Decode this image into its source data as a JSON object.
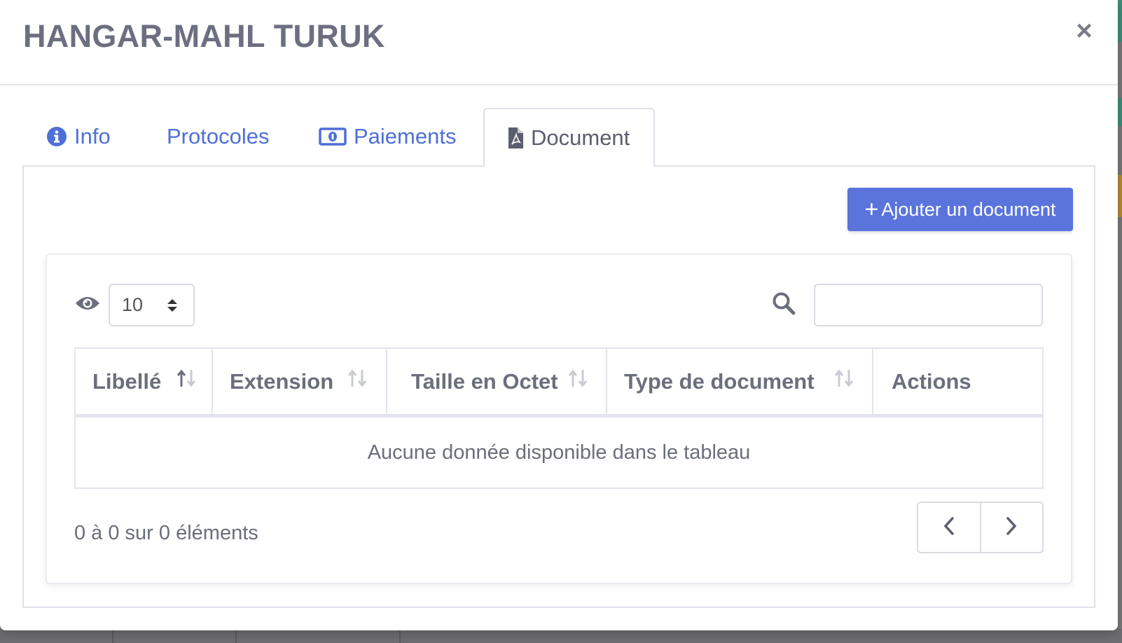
{
  "modal": {
    "title": "HANGAR-MAHL TURUK",
    "close_label": "×"
  },
  "tabs": [
    {
      "label": "Info",
      "icon": "info-circle-icon",
      "active": false
    },
    {
      "label": "Protocoles",
      "icon": "",
      "active": false
    },
    {
      "label": "Paiements",
      "icon": "money-bill-icon",
      "active": false
    },
    {
      "label": "Document",
      "icon": "file-pdf-icon",
      "active": true
    }
  ],
  "toolbar": {
    "add_label": "Ajouter un document"
  },
  "table_controls": {
    "page_length": "10",
    "search_value": ""
  },
  "table": {
    "columns": [
      "Libellé",
      "Extension",
      "Taille en Octet",
      "Type de document",
      "Actions"
    ],
    "rows": [],
    "empty_message": "Aucune donnée disponible dans le tableau"
  },
  "footer": {
    "info": "0 à 0 sur 0 éléments"
  },
  "colors": {
    "accent": "#5a74dc",
    "link": "#4e6fd8",
    "title": "#6c6f80",
    "text_muted": "#6b6e7c"
  }
}
